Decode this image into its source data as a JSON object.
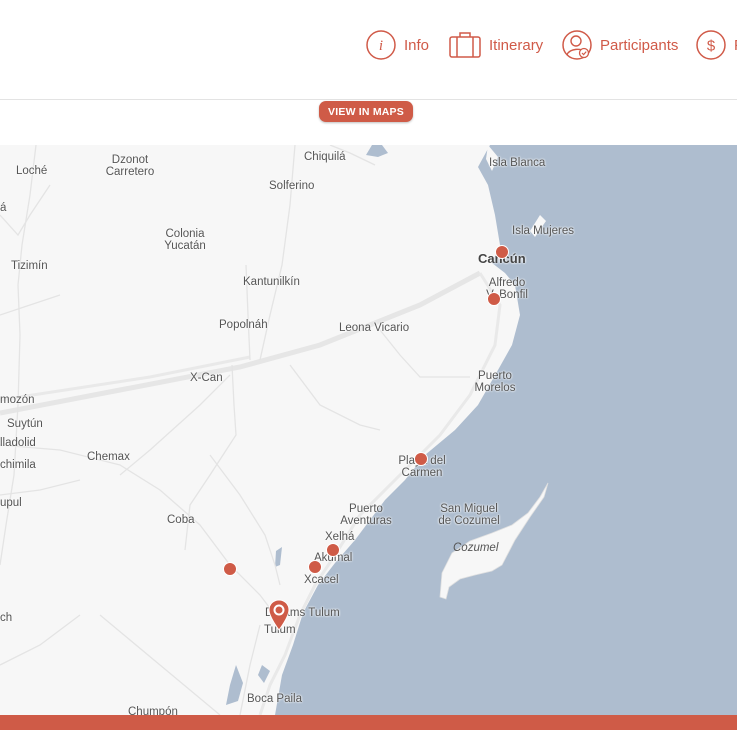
{
  "nav": {
    "info": "Info",
    "itinerary": "Itinerary",
    "participants": "Participants",
    "price_partial": "P"
  },
  "view_in_maps": "VIEW IN MAPS",
  "map": {
    "labels": {
      "loche": "Loché",
      "dzonot": "Dzonot Carretero",
      "chiquila": "Chiquilá",
      "isla_blanca": "Isla Blanca",
      "solferino": "Solferino",
      "a_partial": "á",
      "colonia": "Colonia Yucatán",
      "isla_mujeres": "Isla Mujeres",
      "tizimin": "Tizimín",
      "cancun": "Cancún",
      "kantunilkin": "Kantunilkín",
      "alfredo": "Alfredo V. Bonfil",
      "popolnah": "Popolnáh",
      "leona": "Leona Vicario",
      "xcan": "X-Can",
      "puerto_morelos": "Puerto Morelos",
      "mozon": "mozón",
      "suytun": "Suytún",
      "lladolid": "lladolid",
      "chimila": "chimila",
      "chemax": "Chemax",
      "playa": "Playa del Carmen",
      "upul": "upul",
      "puerto_aventuras": "Puerto Aventuras",
      "san_miguel": "San Miguel de Cozumel",
      "coba": "Coba",
      "xelha": "Xelhá",
      "cozumel": "Cozumel",
      "akumal": "Akumal",
      "xcacel": "Xcacel",
      "ch": "ch",
      "dreams": "Dreams Tulum",
      "tulum": "Tulum",
      "boca_paila": "Boca Paila",
      "chumpon": "Chumpón"
    },
    "pin_names": [
      "Cancún",
      "Alfredo V. Bonfil",
      "Playa del Carmen",
      "Akumal",
      "Xcacel",
      "Coba",
      "Tulum"
    ],
    "colors": {
      "water": "#aebdcf",
      "land": "#f7f7f7",
      "road": "#ffffff",
      "accent": "#cf5b47"
    }
  }
}
